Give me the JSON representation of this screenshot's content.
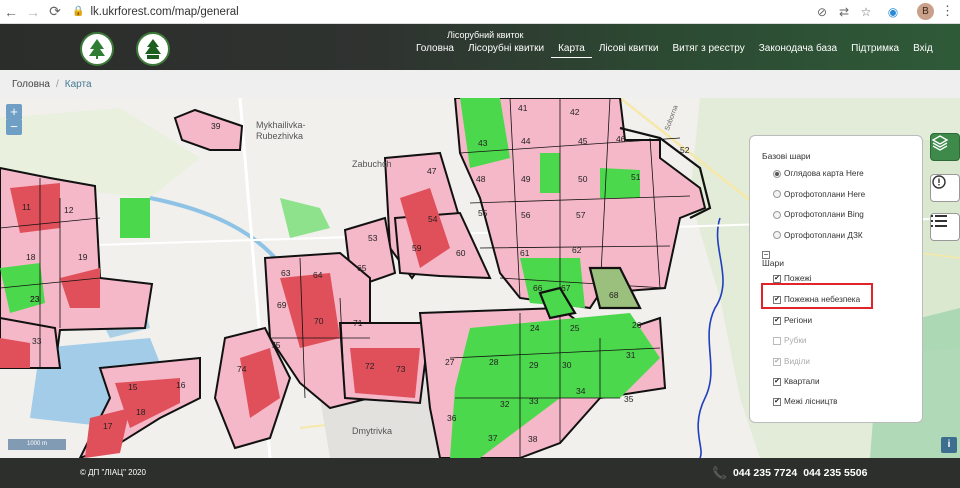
{
  "browser": {
    "url": "lk.ukrforest.com/map/general",
    "avatar_letter": "B"
  },
  "header": {
    "tagline": "Лісорубний квиток",
    "nav": [
      {
        "label": "Головна",
        "active": false
      },
      {
        "label": "Лісорубні квитки",
        "active": false
      },
      {
        "label": "Карта",
        "active": true
      },
      {
        "label": "Лісові квитки",
        "active": false
      },
      {
        "label": "Витяг з реєстру",
        "active": false
      },
      {
        "label": "Законодача база",
        "active": false
      },
      {
        "label": "Підтримка",
        "active": false
      },
      {
        "label": "Вхід",
        "active": false
      }
    ]
  },
  "breadcrumb": {
    "home": "Головна",
    "current": "Карта"
  },
  "map": {
    "zoom_in": "+",
    "zoom_out": "−",
    "scale": "1000 m",
    "places": {
      "mykhailivka": "Mykhailivka-",
      "rubezhivka": "Rubezhivka",
      "zabuchchya": "Zabuchch",
      "dmytrivka": "Dmytrivka",
      "road": "Soborna"
    },
    "blocks": [
      {
        "n": "39"
      },
      {
        "n": "41"
      },
      {
        "n": "42"
      },
      {
        "n": "43"
      },
      {
        "n": "44"
      },
      {
        "n": "45"
      },
      {
        "n": "46"
      },
      {
        "n": "47"
      },
      {
        "n": "48"
      },
      {
        "n": "49"
      },
      {
        "n": "50"
      },
      {
        "n": "51"
      },
      {
        "n": "52"
      },
      {
        "n": "53"
      },
      {
        "n": "54"
      },
      {
        "n": "55"
      },
      {
        "n": "56"
      },
      {
        "n": "57"
      },
      {
        "n": "59"
      },
      {
        "n": "60"
      },
      {
        "n": "61"
      },
      {
        "n": "62"
      },
      {
        "n": "63"
      },
      {
        "n": "64"
      },
      {
        "n": "65"
      },
      {
        "n": "66"
      },
      {
        "n": "67"
      },
      {
        "n": "68"
      },
      {
        "n": "69"
      },
      {
        "n": "70"
      },
      {
        "n": "71"
      },
      {
        "n": "72"
      },
      {
        "n": "73"
      },
      {
        "n": "74"
      },
      {
        "n": "75"
      },
      {
        "n": "11"
      },
      {
        "n": "12"
      },
      {
        "n": "18"
      },
      {
        "n": "19"
      },
      {
        "n": "23"
      },
      {
        "n": "24"
      },
      {
        "n": "25"
      },
      {
        "n": "26"
      },
      {
        "n": "27"
      },
      {
        "n": "28"
      },
      {
        "n": "29"
      },
      {
        "n": "30"
      },
      {
        "n": "31"
      },
      {
        "n": "32"
      },
      {
        "n": "33"
      },
      {
        "n": "34"
      },
      {
        "n": "35"
      },
      {
        "n": "36"
      },
      {
        "n": "37"
      },
      {
        "n": "38"
      },
      {
        "n": "15"
      },
      {
        "n": "16"
      },
      {
        "n": "17"
      },
      {
        "n": "18"
      },
      {
        "n": "23"
      },
      {
        "n": "33"
      }
    ],
    "colors": {
      "forest_pink": "#f5b8c8",
      "fire_red": "#e0505a",
      "green": "#4cd84c",
      "water": "#8ec3e6",
      "boundary": "#111111"
    }
  },
  "layers_panel": {
    "base_title": "Базові шари",
    "base_layers": [
      {
        "label": "Оглядова карта Here",
        "selected": true
      },
      {
        "label": "Ортофотоплани Here",
        "selected": false
      },
      {
        "label": "Ортофотоплани Bing",
        "selected": false
      },
      {
        "label": "Ортофотоплани ДЗК",
        "selected": false
      }
    ],
    "layers_title": "Шари",
    "layers": [
      {
        "label": "Пожежі",
        "checked": true,
        "disabled": false
      },
      {
        "label": "Пожежна небезпека",
        "checked": true,
        "disabled": false
      },
      {
        "label": "Регіони",
        "checked": true,
        "disabled": false
      },
      {
        "label": "Рубки",
        "checked": false,
        "disabled": true
      },
      {
        "label": "Виділи",
        "checked": true,
        "disabled": true
      },
      {
        "label": "Квартали",
        "checked": true,
        "disabled": false
      },
      {
        "label": "Межі лісництв",
        "checked": true,
        "disabled": false
      }
    ]
  },
  "footer": {
    "copyright": "© ДП \"ЛІАЦ\" 2020",
    "phone1": "044 235 7724",
    "phone2": "044 235 5506"
  }
}
